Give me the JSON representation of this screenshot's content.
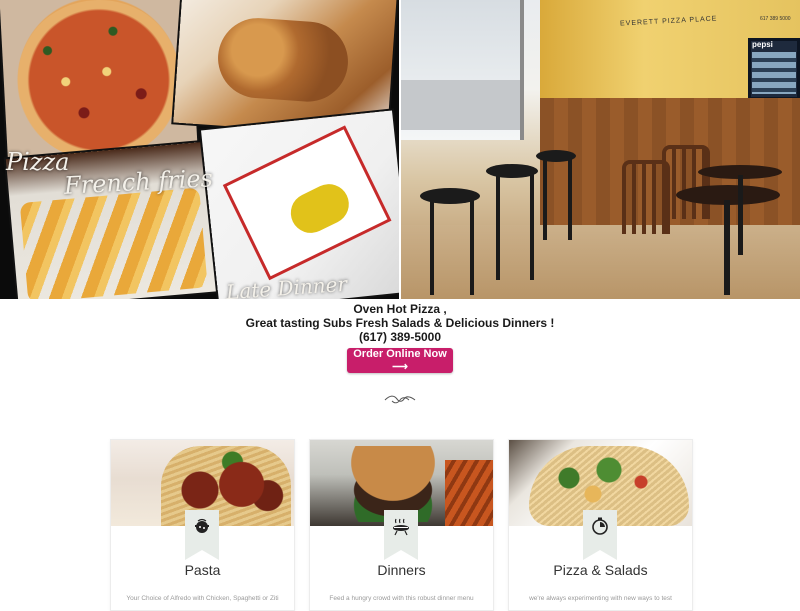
{
  "hero": {
    "collage_labels": {
      "pizza": "Pizza",
      "fries": "French fries",
      "dinner": "Late Dinner"
    },
    "restaurant_sign": "EVERETT PIZZA PLACE",
    "sign_phone": "617 389 5000",
    "fridge_brand": "pepsi"
  },
  "intro": {
    "line1": "Oven Hot Pizza ,",
    "line2": "Great tasting Subs Fresh Salads & Delicious Dinners !",
    "phone": "(617) 389-5000"
  },
  "cta": {
    "label": "Order Online Now ⟶",
    "color": "#c81e6a"
  },
  "cards": [
    {
      "title": "Pasta",
      "description": "Your Choice of Alfredo with Chicken, Spaghetti or Ziti",
      "icon": "pot-icon"
    },
    {
      "title": "Dinners",
      "description": "Feed a hungry crowd with this robust dinner menu",
      "icon": "grill-icon"
    },
    {
      "title": "Pizza & Salads",
      "description": "we're always experimenting with new ways to test",
      "icon": "timer-icon"
    }
  ],
  "colors": {
    "ribbon": "#e7ece8",
    "text": "#1a1a1a"
  }
}
